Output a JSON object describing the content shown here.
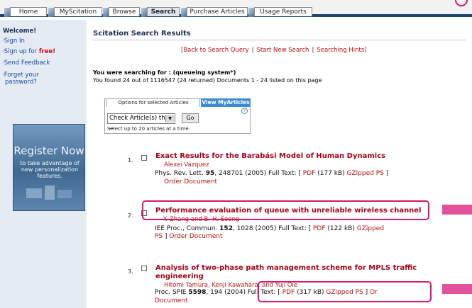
{
  "tabs": [
    {
      "label": "Home"
    },
    {
      "label": "MyScitation"
    },
    {
      "label": "Browse"
    },
    {
      "label": "Search"
    },
    {
      "label": "Purchase Articles"
    },
    {
      "label": "Usage Reports"
    }
  ],
  "sidebar": {
    "welcome": "Welcome!",
    "links": [
      {
        "label": "Sign In"
      },
      {
        "label": "Sign up for ",
        "emphasis": "free!"
      },
      {
        "label": "Send Feedback"
      },
      {
        "label": "Forget your"
      },
      {
        "label": "password?"
      }
    ],
    "register": {
      "title": "Register Now",
      "subtitle": "to take advantage of new personalization features."
    }
  },
  "main": {
    "heading": "Scitation Search Results",
    "links": [
      "Back to Search Query",
      "Start New Search",
      "Searching Hints"
    ],
    "query_line": "You were searching for : (queueing system*)",
    "found_line": "You found 24 out of 1116547 (24 returned)   Documents 1 - 24 listed on this page",
    "options": {
      "tab_options": "Options for selected Articles",
      "tab_view": "View MyArticles",
      "select_value": "Check Article(s) then ...",
      "go_label": "Go",
      "help_label": "?",
      "hint": "Select up to 20 articles at a time."
    },
    "results": [
      {
        "num": "1.",
        "title_line1": "Exact Results for the Barabási Model of Human Dynamics",
        "title_line2": "",
        "authors": "Alexei Vázquez",
        "journal": "Phys. Rev. Lett.",
        "volume": "95",
        "citation_rest": ", 248701 (2005) Full Text: [",
        "pdf": "PDF",
        "size": "(177 kB)",
        "gzip": "GZipped PS",
        "close": "]",
        "order": "Order Document"
      },
      {
        "num": "2.",
        "title_line1": "Performance evaluation of queue with unreliable wireless channel",
        "title_line2": "",
        "authors": "Y. Zhang and B.-H. Soong",
        "journal": "IEE Proc., Commun.",
        "volume": "152",
        "citation_rest": ", 1028 (2005) Full Text: [",
        "pdf": "PDF",
        "size": "(122 kB)",
        "gzip": "GZipped",
        "gzip_wrap": "PS",
        "close": "]",
        "order": "Order Document"
      },
      {
        "num": "3.",
        "title_line1": "Analysis of two-phase path management scheme for MPLS traffic",
        "title_line2": "engineering",
        "authors": "Hitomi Tamura, Kenji Kawahara, and Yuji Oie",
        "journal": "Proc. SPIE",
        "volume": "5598",
        "citation_rest": ", 194 (2004) Full Text: [",
        "pdf": "PDF",
        "size": "(317 kB)",
        "gzip": "GZipped PS",
        "close": "]",
        "order_prefix": "Or",
        "order": "Document"
      }
    ]
  },
  "colors": {
    "accent_navy": "#1d4670",
    "link_red": "#b21212",
    "title_red": "#a3041a",
    "highlight_pink": "#d6176a",
    "sidebar_bg": "#e5ebf2"
  },
  "icons": [
    "corner-annotation-icon",
    "help-icon",
    "dropdown-arrow-icon",
    "register-graphic-icon"
  ]
}
